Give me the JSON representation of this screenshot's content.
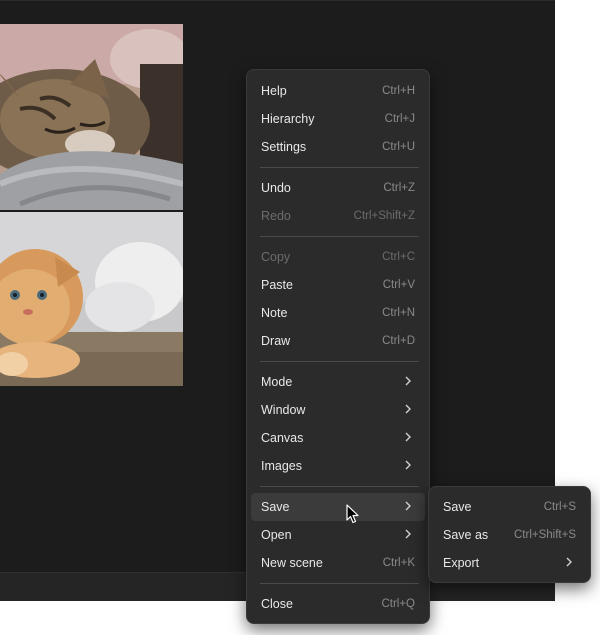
{
  "menu": {
    "groups": [
      [
        {
          "label": "Help",
          "shortcut": "Ctrl+H"
        },
        {
          "label": "Hierarchy",
          "shortcut": "Ctrl+J"
        },
        {
          "label": "Settings",
          "shortcut": "Ctrl+U"
        }
      ],
      [
        {
          "label": "Undo",
          "shortcut": "Ctrl+Z"
        },
        {
          "label": "Redo",
          "shortcut": "Ctrl+Shift+Z",
          "disabled": true
        }
      ],
      [
        {
          "label": "Copy",
          "shortcut": "Ctrl+C",
          "disabled": true
        },
        {
          "label": "Paste",
          "shortcut": "Ctrl+V"
        },
        {
          "label": "Note",
          "shortcut": "Ctrl+N"
        },
        {
          "label": "Draw",
          "shortcut": "Ctrl+D"
        }
      ],
      [
        {
          "label": "Mode",
          "submenu": true
        },
        {
          "label": "Window",
          "submenu": true
        },
        {
          "label": "Canvas",
          "submenu": true
        },
        {
          "label": "Images",
          "submenu": true
        }
      ],
      [
        {
          "label": "Save",
          "submenu": true,
          "highlighted": true
        },
        {
          "label": "Open",
          "submenu": true
        },
        {
          "label": "New scene",
          "shortcut": "Ctrl+K"
        }
      ],
      [
        {
          "label": "Close",
          "shortcut": "Ctrl+Q"
        }
      ]
    ]
  },
  "save_submenu": {
    "items": [
      {
        "label": "Save",
        "shortcut": "Ctrl+S"
      },
      {
        "label": "Save as",
        "shortcut": "Ctrl+Shift+S"
      },
      {
        "label": "Export",
        "submenu": true
      }
    ]
  },
  "images": [
    {
      "name": "cat-photo-tabby",
      "subject": "sleeping tabby cat"
    },
    {
      "name": "cat-photo-kitten",
      "subject": "orange kitten lying down"
    }
  ],
  "colors": {
    "canvas": "#1c1c1c",
    "menu_bg": "#2b2b2b",
    "menu_highlight": "#3b3b3b",
    "text": "#e8e8e8",
    "shortcut_text": "#8a8a8a",
    "disabled_text": "#6c6c6c"
  }
}
